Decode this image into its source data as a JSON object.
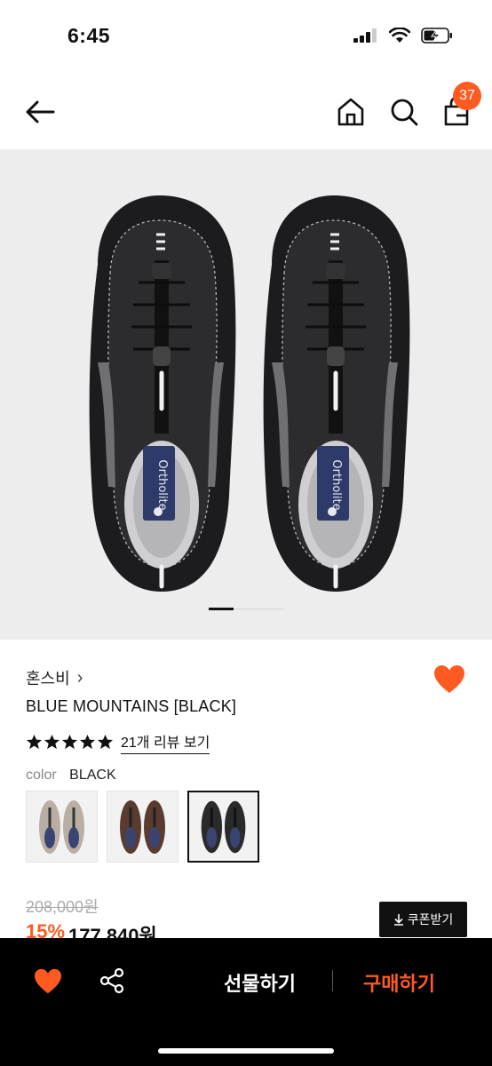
{
  "status": {
    "time": "6:45"
  },
  "nav": {
    "cart_count": "37"
  },
  "product": {
    "brand": "혼스비",
    "brand_chevron": "›",
    "name": "BLUE MOUNTAINS [BLACK]",
    "rating": 5,
    "review_link": "21개 리뷰 보기",
    "color_label": "color",
    "color_value": "BLACK",
    "swatches": [
      {
        "name": "beige",
        "color": "#b9aea4"
      },
      {
        "name": "brown",
        "color": "#5a3b2f"
      },
      {
        "name": "black",
        "color": "#2a2a2a",
        "selected": true
      }
    ],
    "original_price": "208,000원",
    "discount": "15%",
    "sale_price": "177,840원",
    "coupon_button": "쿠폰받기"
  },
  "gallery": {
    "total_pages": 3,
    "current_page": 1
  },
  "bottom_bar": {
    "gift_label": "선물하기",
    "buy_label": "구매하기"
  },
  "colors": {
    "accent": "#ff5a1f",
    "dark": "#111111"
  },
  "icons": [
    "back-arrow-icon",
    "home-icon",
    "search-icon",
    "shopping-bag-icon",
    "chevron-right-icon",
    "heart-icon",
    "star-icon",
    "download-icon",
    "share-icon"
  ]
}
